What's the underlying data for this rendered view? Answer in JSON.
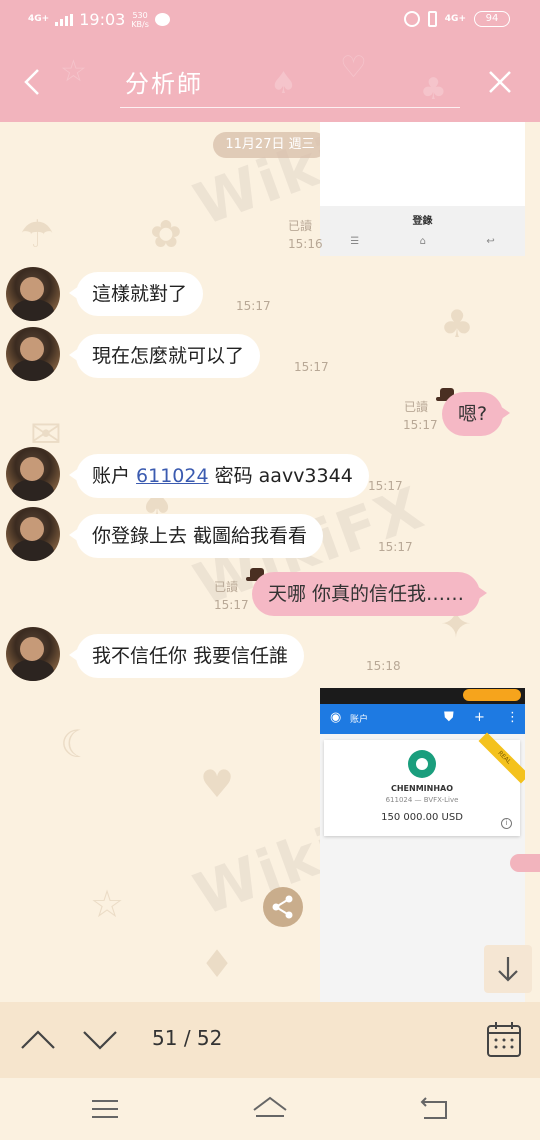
{
  "status_bar": {
    "network": "4G+",
    "time": "19:03",
    "speed": "530",
    "speed_unit": "KB/s",
    "network_right": "4G+",
    "battery": "94"
  },
  "header": {
    "title": "分析師"
  },
  "chat": {
    "date": "11月27日 週三",
    "image1": {
      "login_label": "登錄",
      "read": "已讀",
      "time": "15:16"
    },
    "messages": [
      {
        "text": "這樣就對了",
        "time": "15:17"
      },
      {
        "text": "現在怎麼就可以了",
        "time": "15:17"
      },
      {
        "text": "嗯?",
        "time": "15:17",
        "read": "已讀"
      },
      {
        "prefix": "账户 ",
        "link": "611024",
        "suffix": "  密码  aavv3344",
        "time": "15:17"
      },
      {
        "text": "你登錄上去   截圖給我看看",
        "time": "15:17"
      },
      {
        "text": "天哪  你真的信任我……",
        "time": "15:17",
        "read": "已讀"
      },
      {
        "text": "我不信任你   我要信任誰",
        "time": "15:18"
      }
    ],
    "image2": {
      "header_title": "账户",
      "account_name": "CHENMINHAO",
      "account_info": "611024 — BVFX-Live",
      "balance": "150 000.00 USD",
      "ribbon": "REAL"
    }
  },
  "footer": {
    "current_page": "51",
    "separator": "/",
    "total_pages": "52"
  },
  "colors": {
    "header_bg": "#f2b4bd",
    "outgoing_bubble": "#f5b8c5",
    "incoming_bubble": "#ffffff",
    "chat_bg": "#fbf1e0",
    "footer_bg": "#f6e5cd"
  }
}
